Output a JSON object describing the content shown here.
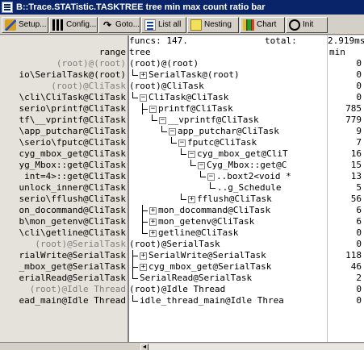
{
  "window": {
    "title": "B::Trace.STATistic.TASKTREE tree min max count ratio bar"
  },
  "toolbar": {
    "buttons": [
      {
        "label": "Setup...",
        "icon": "setup-icon"
      },
      {
        "label": "Config...",
        "icon": "config-icon"
      },
      {
        "label": "Goto...",
        "icon": "goto-icon"
      },
      {
        "label": "List all",
        "icon": "list-icon"
      },
      {
        "label": "Nesting",
        "icon": "nesting-icon"
      },
      {
        "label": "Chart",
        "icon": "chart-icon"
      },
      {
        "label": "Init",
        "icon": "init-icon"
      }
    ]
  },
  "header": {
    "funcs": "funcs: 147.",
    "total_label": "total:",
    "total_value": "2.919ms",
    "range_label": "range",
    "tree_label": "tree",
    "min_label": "min"
  },
  "rows": [
    {
      "range": "(root)@(root)",
      "range_dim": true,
      "tree": "(root)@(root)",
      "min": "0"
    },
    {
      "range": "io\\SerialTask@(root)",
      "range_dim": false,
      "tree": "SerialTask@(root)",
      "min": "0"
    },
    {
      "range": "(root)@CliTask",
      "range_dim": true,
      "tree": "(root)@CliTask",
      "min": "0"
    },
    {
      "range": "\\cli\\CliTask@CliTask",
      "range_dim": false,
      "tree": "CliTask@CliTask",
      "min": "0"
    },
    {
      "range": "serio\\printf@CliTask",
      "range_dim": false,
      "tree": "printf@CliTask",
      "min": "785"
    },
    {
      "range": "tf\\__vprintf@CliTask",
      "range_dim": false,
      "tree": "__vprintf@CliTask",
      "min": "779"
    },
    {
      "range": "\\app_putchar@CliTask",
      "range_dim": false,
      "tree": "app_putchar@CliTask",
      "min": "9"
    },
    {
      "range": "\\serio\\fputc@CliTask",
      "range_dim": false,
      "tree": "fputc@CliTask",
      "min": "7"
    },
    {
      "range": "cyg_mbox_get@CliTask",
      "range_dim": false,
      "tree": "cyg_mbox_get@CliT",
      "min": "16"
    },
    {
      "range": "yg_Mbox::get@CliTask",
      "range_dim": false,
      "tree": "Cyg_Mbox::get@C",
      "min": "15"
    },
    {
      "range": "int=4>::get@CliTask",
      "range_dim": false,
      "tree": "..boxt2<void *",
      "min": "13"
    },
    {
      "range": "unlock_inner@CliTask",
      "range_dim": false,
      "tree": "..g_Schedule",
      "min": "5"
    },
    {
      "range": "serio\\fflush@CliTask",
      "range_dim": false,
      "tree": "fflush@CliTask",
      "min": "56"
    },
    {
      "range": "on_docommand@CliTask",
      "range_dim": false,
      "tree": "mon_docommand@CliTask",
      "min": "6"
    },
    {
      "range": "b\\mon_getenv@CliTask",
      "range_dim": false,
      "tree": "mon_getenv@CliTask",
      "min": "6"
    },
    {
      "range": "\\cli\\getline@CliTask",
      "range_dim": false,
      "tree": "getline@CliTask",
      "min": "0"
    },
    {
      "range": "(root)@SerialTask",
      "range_dim": true,
      "tree": "(root)@SerialTask",
      "min": "0"
    },
    {
      "range": "rialWrite@SerialTask",
      "range_dim": false,
      "tree": "SerialWrite@SerialTask",
      "min": "118"
    },
    {
      "range": "_mbox_get@SerialTask",
      "range_dim": false,
      "tree": "cyg_mbox_get@SerialTask",
      "min": "46"
    },
    {
      "range": "erialRead@SerialTask",
      "range_dim": false,
      "tree": "SerialRead@SerialTask",
      "min": "2"
    },
    {
      "range": "(root)@Idle Thread",
      "range_dim": true,
      "tree": "(root)@Idle Thread",
      "min": "0"
    },
    {
      "range": "ead_main@Idle Thread",
      "range_dim": false,
      "tree": "idle_thread_main@Idle Threa",
      "min": "0"
    }
  ],
  "scrollbar": {
    "left_arrow": "◄"
  }
}
